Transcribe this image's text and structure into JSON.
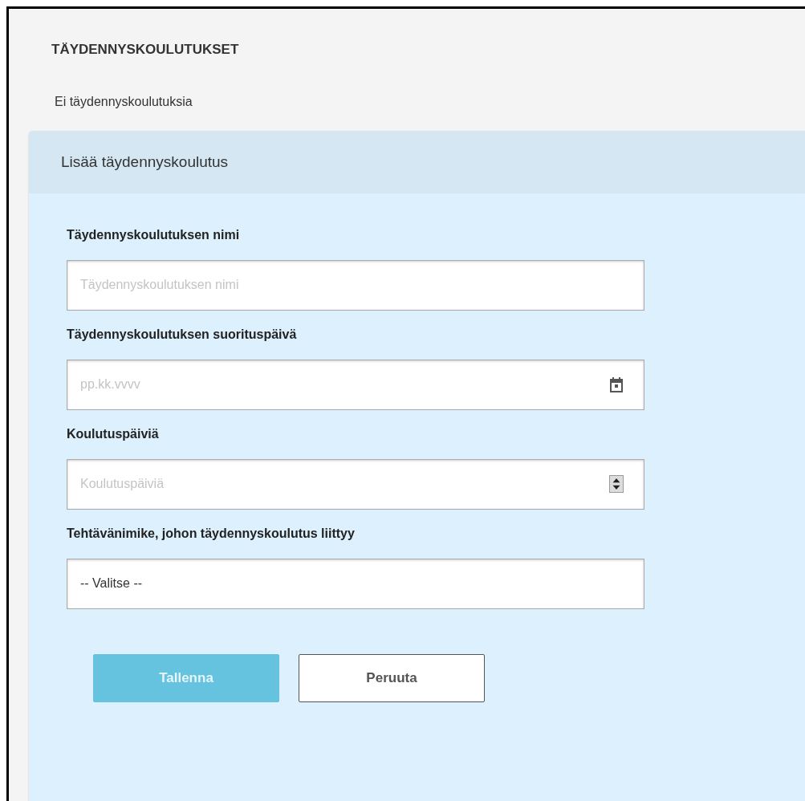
{
  "heading": "TÄYDENNYSKOULUTUKSET",
  "empty_message": "Ei täydennyskoulutuksia",
  "panel": {
    "title": "Lisää täydennyskoulutus",
    "fields": [
      {
        "kind": "text",
        "label": "Täydennyskoulutuksen nimi",
        "placeholder": "Täydennyskoulutuksen nimi"
      },
      {
        "kind": "date",
        "label": "Täydennyskoulutuksen suorituspäivä",
        "placeholder": "pp.kk.vvvv"
      },
      {
        "kind": "number",
        "label": "Koulutuspäiviä",
        "placeholder": "Koulutuspäiviä"
      },
      {
        "kind": "select",
        "label": "Tehtävänimike, johon täydennyskoulutus liittyy",
        "value": "-- Valitse --"
      }
    ],
    "buttons": [
      {
        "kind": "primary",
        "label": "Tallenna",
        "disabled": true
      },
      {
        "kind": "secondary",
        "label": "Peruuta",
        "disabled": false
      }
    ]
  }
}
